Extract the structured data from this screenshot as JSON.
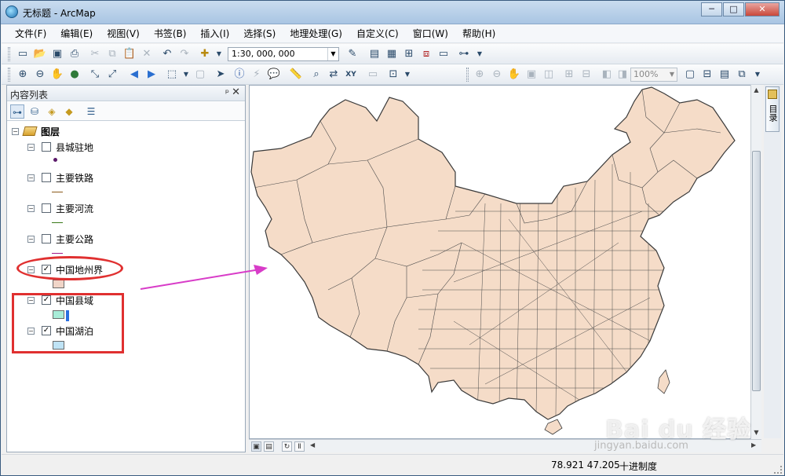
{
  "window": {
    "title": "无标题 - ArcMap",
    "minimize": "─",
    "maximize": "□",
    "close": "✕"
  },
  "menu": [
    "文件(F)",
    "编辑(E)",
    "视图(V)",
    "书签(B)",
    "插入(I)",
    "选择(S)",
    "地理处理(G)",
    "自定义(C)",
    "窗口(W)",
    "帮助(H)"
  ],
  "toolbar": {
    "scale": "1:30, 000, 000",
    "zoom": "100%"
  },
  "toc": {
    "title": "内容列表",
    "pin": "ᵖ",
    "close": "✕",
    "root_label": "图层",
    "layers": [
      {
        "label": "县城驻地",
        "checked": false,
        "symbol": "point",
        "color": "#5b1a6a"
      },
      {
        "label": "主要铁路",
        "checked": false,
        "symbol": "line",
        "color": "#8a5a1a"
      },
      {
        "label": "主要河流",
        "checked": false,
        "symbol": "line",
        "color": "#3a7a1a"
      },
      {
        "label": "主要公路",
        "checked": false,
        "symbol": "line",
        "color": "#a01a8a"
      },
      {
        "label": "中国地州界",
        "checked": true,
        "symbol": "fill",
        "color": "#f0d5c8"
      },
      {
        "label": "中国县域",
        "checked": true,
        "symbol": "fill",
        "color": "#a8ecd8"
      },
      {
        "label": "中国湖泊",
        "checked": true,
        "symbol": "fill",
        "color": "#bfe3f5"
      }
    ],
    "checkmark": "✓",
    "expander": "−"
  },
  "map": {
    "fill": "#f5dcc8",
    "stroke": "#3a3a3a"
  },
  "catalog": {
    "label": "目录"
  },
  "status": {
    "coords": "78.921  47.205",
    "units": "十进制度"
  },
  "watermark": {
    "brand": "Bai du 经验",
    "url": "jingyan.baidu.com"
  },
  "annotation_colors": {
    "marker": "#e03030",
    "arrow": "#d83cc8"
  }
}
